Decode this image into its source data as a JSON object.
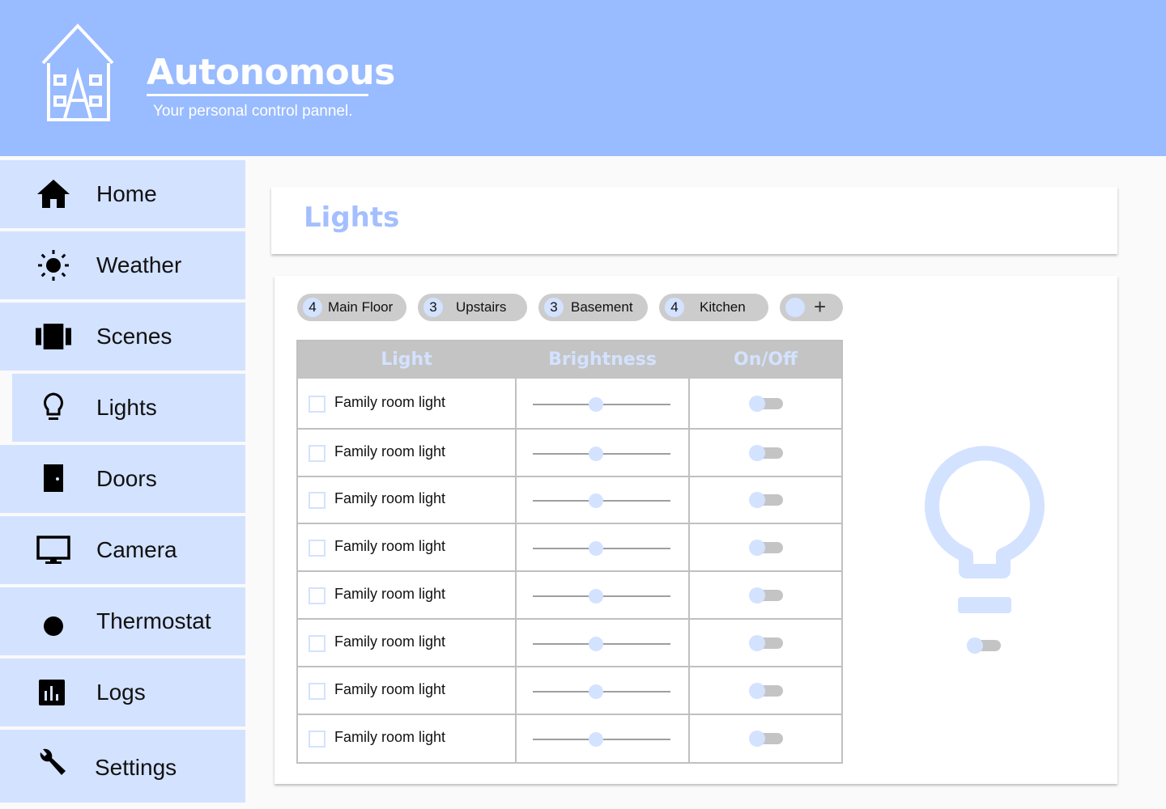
{
  "header": {
    "title": "Autonomous",
    "subtitle": "Your personal control pannel.",
    "logo_icon": "house-icon"
  },
  "sidebar": {
    "items": [
      {
        "label": "Home",
        "icon": "home-icon",
        "active": false
      },
      {
        "label": "Weather",
        "icon": "sun-icon",
        "active": false
      },
      {
        "label": "Scenes",
        "icon": "scenes-icon",
        "active": false
      },
      {
        "label": "Lights",
        "icon": "lightbulb-icon",
        "active": true
      },
      {
        "label": "Doors",
        "icon": "door-icon",
        "active": false
      },
      {
        "label": "Camera",
        "icon": "monitor-icon",
        "active": false
      },
      {
        "label": "Thermostat",
        "icon": "dot-icon",
        "active": false
      },
      {
        "label": "Logs",
        "icon": "bar-chart-icon",
        "active": false
      },
      {
        "label": "Settings",
        "icon": "wrench-icon",
        "active": false
      }
    ]
  },
  "page": {
    "title": "Lights"
  },
  "groups": [
    {
      "count": "4",
      "label": "Main Floor"
    },
    {
      "count": "3",
      "label": "Upstairs"
    },
    {
      "count": "3",
      "label": "Basement"
    },
    {
      "count": "4",
      "label": "Kitchen"
    }
  ],
  "add_group": {
    "label": "+"
  },
  "table": {
    "headers": {
      "light": "Light",
      "brightness": "Brightness",
      "on_off": "On/Off"
    },
    "rows": [
      {
        "name": "Family room light",
        "brightness": 0.45,
        "on": false,
        "checked": false
      },
      {
        "name": "Family room light",
        "brightness": 0.45,
        "on": false,
        "checked": false
      },
      {
        "name": "Family room light",
        "brightness": 0.45,
        "on": false,
        "checked": false
      },
      {
        "name": "Family room light",
        "brightness": 0.45,
        "on": false,
        "checked": false
      },
      {
        "name": "Family room light",
        "brightness": 0.45,
        "on": false,
        "checked": false
      },
      {
        "name": "Family room light",
        "brightness": 0.45,
        "on": false,
        "checked": false
      },
      {
        "name": "Family room light",
        "brightness": 0.45,
        "on": false,
        "checked": false
      },
      {
        "name": "Family room light",
        "brightness": 0.45,
        "on": false,
        "checked": false
      }
    ]
  },
  "preview": {
    "icon": "lightbulb-icon",
    "on": false
  },
  "colors": {
    "header_bg": "#99bbff",
    "nav_bg": "#d3e2ff",
    "accent": "#a4bfff",
    "table_head": "#c4c4c4"
  }
}
